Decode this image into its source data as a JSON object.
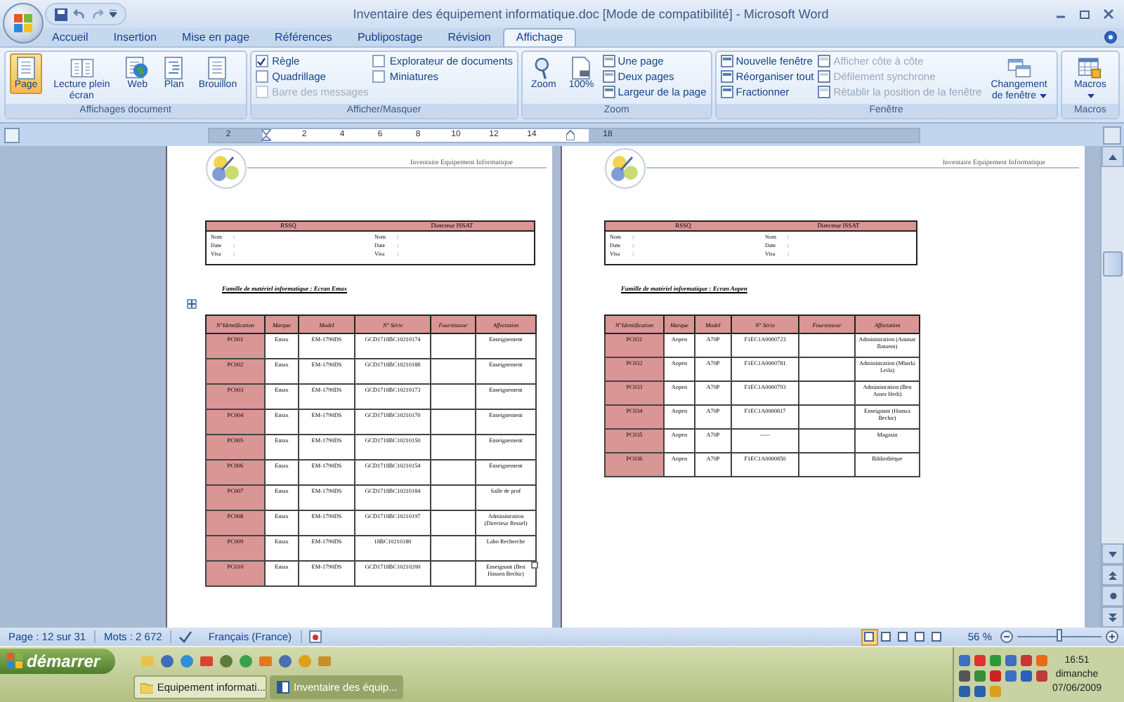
{
  "window": {
    "title": "Inventaire des équipement informatique.doc [Mode de compatibilité] - Microsoft Word"
  },
  "tabs": [
    {
      "label": "Accueil",
      "selected": false
    },
    {
      "label": "Insertion",
      "selected": false
    },
    {
      "label": "Mise en page",
      "selected": false
    },
    {
      "label": "Références",
      "selected": false
    },
    {
      "label": "Publipostage",
      "selected": false
    },
    {
      "label": "Révision",
      "selected": false
    },
    {
      "label": "Affichage",
      "selected": true
    }
  ],
  "ribbon": [
    {
      "title": "Affichages document",
      "items": [
        {
          "kind": "large",
          "label": "Page",
          "selected": true
        },
        {
          "kind": "large",
          "label": "Lecture plein écran",
          "selected": false
        },
        {
          "kind": "large",
          "label": "Web",
          "selected": false
        },
        {
          "kind": "large",
          "label": "Plan",
          "selected": false
        },
        {
          "kind": "large",
          "label": "Brouillon",
          "selected": false
        }
      ]
    },
    {
      "title": "Afficher/Masquer",
      "items": [
        {
          "kind": "check",
          "label": "Règle",
          "checked": true,
          "disabled": false
        },
        {
          "kind": "check",
          "label": "Quadrillage",
          "checked": false,
          "disabled": false
        },
        {
          "kind": "check",
          "label": "Barre des messages",
          "checked": false,
          "disabled": true
        },
        {
          "kind": "check",
          "label": "Explorateur de documents",
          "checked": false,
          "disabled": false
        },
        {
          "kind": "check",
          "label": "Miniatures",
          "checked": false,
          "disabled": false
        }
      ]
    },
    {
      "title": "Zoom",
      "items": [
        {
          "kind": "large",
          "label": "Zoom"
        },
        {
          "kind": "large",
          "label": "100%"
        },
        {
          "kind": "small",
          "label": "Une page",
          "disabled": false
        },
        {
          "kind": "small",
          "label": "Deux pages",
          "disabled": false
        },
        {
          "kind": "small",
          "label": "Largeur de la page",
          "disabled": false
        }
      ]
    },
    {
      "title": "Fenêtre",
      "items": [
        {
          "kind": "small",
          "label": "Nouvelle fenêtre",
          "disabled": false
        },
        {
          "kind": "small",
          "label": "Réorganiser tout",
          "disabled": false
        },
        {
          "kind": "small",
          "label": "Fractionner",
          "disabled": false
        },
        {
          "kind": "small",
          "label": "Afficher côte à côte",
          "disabled": true
        },
        {
          "kind": "small",
          "label": "Défilement synchrone",
          "disabled": true
        },
        {
          "kind": "small",
          "label": "Rétablir la position de la fenêtre",
          "disabled": true
        },
        {
          "kind": "large",
          "label": "Changement de fenêtre",
          "dropdown": true
        }
      ]
    },
    {
      "title": "Macros",
      "items": [
        {
          "kind": "large",
          "label": "Macros",
          "dropdown": true
        }
      ]
    }
  ],
  "ruler": {
    "labels": [
      "2",
      "2",
      "4",
      "6",
      "8",
      "10",
      "12",
      "14",
      "18"
    ]
  },
  "pages": [
    {
      "header": "Inventaire Equipement Informatique",
      "signatures": [
        {
          "title": "RSSQ",
          "fields": [
            [
              "Nom",
              ":"
            ],
            [
              "Date",
              ":"
            ],
            [
              "Visa",
              ":"
            ]
          ]
        },
        {
          "title": "Directeur ISSAT",
          "fields": [
            [
              "Nom",
              ":"
            ],
            [
              "Date",
              ":"
            ],
            [
              "Visa",
              ":"
            ]
          ]
        }
      ],
      "family": "Famille de matériel informatique : Ecran Emax",
      "columns": [
        "N°Identification",
        "Marque",
        "Model",
        "N° Série",
        "Fournisseur",
        "Affectation"
      ],
      "rows": [
        {
          "id": "PC001",
          "marque": "Emax",
          "model": "EM-1790DS",
          "serie": "GCD1718BC10210174",
          "affectation": "Enseignement"
        },
        {
          "id": "PC002",
          "marque": "Emax",
          "model": "EM-1790DS",
          "serie": "GCD1718BC10210188",
          "affectation": "Enseignement"
        },
        {
          "id": "PC003",
          "marque": "Emax",
          "model": "EM-1790DS",
          "serie": "GCD1718BC10210173",
          "affectation": "Enseignement"
        },
        {
          "id": "PC004",
          "marque": "Emax",
          "model": "EM-1790DS",
          "serie": "GCD1718BC10210170",
          "affectation": "Enseignement"
        },
        {
          "id": "PC005",
          "marque": "Emax",
          "model": "EM-1790DS",
          "serie": "GCD1718BC10210150",
          "affectation": "Enseignement"
        },
        {
          "id": "PC006",
          "marque": "Emax",
          "model": "EM-1790DS",
          "serie": "GCD1718BC10210154",
          "affectation": "Enseignement"
        },
        {
          "id": "PC007",
          "marque": "Emax",
          "model": "EM-1790DS",
          "serie": "GCD1718BC10210184",
          "affectation": "Salle de prof"
        },
        {
          "id": "PC008",
          "marque": "Emax",
          "model": "EM-1790DS",
          "serie": "GCD1718BC10210197",
          "affectation": "Administration (Directeur Ressel)"
        },
        {
          "id": "PC009",
          "marque": "Emax",
          "model": "EM-1790DS",
          "serie": "18BC10210180",
          "affectation": "Labo Recherche"
        },
        {
          "id": "PC010",
          "marque": "Emax",
          "model": "EM-1790DS",
          "serie": "GCD1718BC10210200",
          "affectation": "Enseignant (Ben Hassen Bechir)"
        }
      ]
    },
    {
      "header": "Inventaire Equipement Informatique",
      "signatures": [
        {
          "title": "RSSQ",
          "fields": [
            [
              "Nom",
              ":"
            ],
            [
              "Date",
              ":"
            ],
            [
              "Visa",
              ":"
            ]
          ]
        },
        {
          "title": "Directeur ISSAT",
          "fields": [
            [
              "Nom",
              ":"
            ],
            [
              "Date",
              ":"
            ],
            [
              "Visa",
              ":"
            ]
          ]
        }
      ],
      "family": "Famille de matériel informatique : Ecran Aopen",
      "columns": [
        "N°Identification",
        "Marque",
        "Model",
        "N° Série",
        "Fournisseur",
        "Affectation"
      ],
      "rows": [
        {
          "id": "PC031",
          "marque": "Aopen",
          "model": "A70P",
          "serie": "F1EC1A0000723",
          "affectation": "Administration (Ammar Bassem)"
        },
        {
          "id": "PC032",
          "marque": "Aopen",
          "model": "A70P",
          "serie": "F1EC1A0000781",
          "affectation": "Administration (Mbarki Leila)"
        },
        {
          "id": "PC033",
          "marque": "Aopen",
          "model": "A70P",
          "serie": "F1EC1A0000793",
          "affectation": "Administration (Ben Amor Hedi)"
        },
        {
          "id": "PC034",
          "marque": "Aopen",
          "model": "A70P",
          "serie": "F1EC1A0000817",
          "affectation": "Enseignant (Hamza Bechir)"
        },
        {
          "id": "PC035",
          "marque": "Aopen",
          "model": "A70P",
          "serie": "-----",
          "affectation": "Magasin"
        },
        {
          "id": "PC036",
          "marque": "Aopen",
          "model": "A70P",
          "serie": "F1EC1A0000850",
          "affectation": "Bibliothèque"
        }
      ]
    }
  ],
  "status": {
    "page": "Page : 12 sur 31",
    "words": "Mots : 2 672",
    "language": "Français (France)",
    "zoom": "56 %",
    "level": 0.5,
    "views": [
      {
        "selected": true
      },
      {
        "selected": false
      },
      {
        "selected": false
      },
      {
        "selected": false
      },
      {
        "selected": false
      }
    ]
  },
  "taskbar": {
    "start": "démarrer",
    "tasks": [
      {
        "label": "Equipement informati...",
        "selected": false
      },
      {
        "label": "Inventaire des équip...",
        "selected": true
      }
    ],
    "clock": [
      "16:51",
      "dimanche",
      "07/06/2009"
    ]
  }
}
